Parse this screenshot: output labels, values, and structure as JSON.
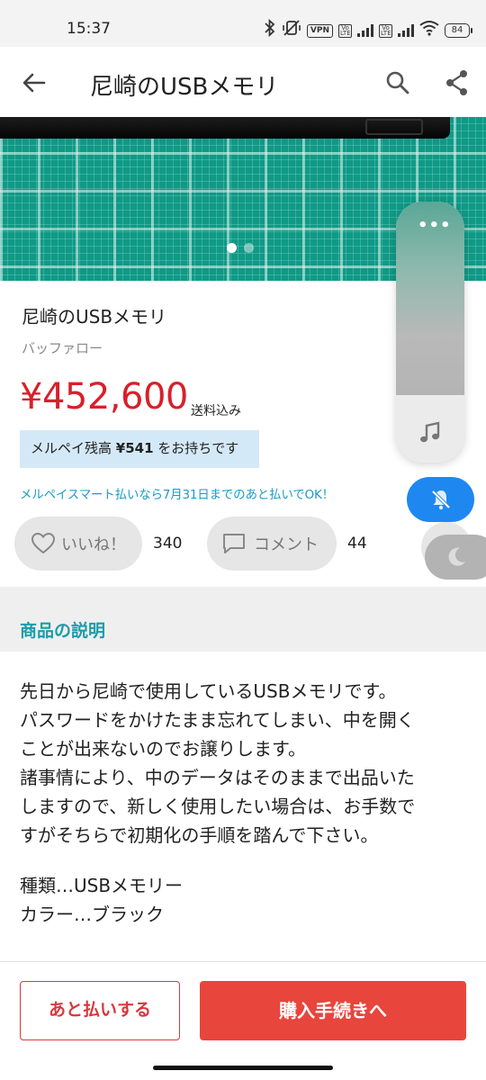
{
  "status_bar": {
    "time": "15:37",
    "icons": [
      "bluetooth-icon",
      "vibrate-off-icon",
      "vpn-icon",
      "volte-icon",
      "signal-icon",
      "volte-icon",
      "signal-icon",
      "wifi-icon",
      "battery-icon"
    ],
    "vpn_label": "VPN",
    "volte_label": "Vo LTE",
    "battery_level": "84"
  },
  "app_bar": {
    "title": "尼崎のUSBメモリ",
    "back_icon": "arrow-left-icon",
    "search_icon": "search-icon",
    "share_icon": "share-icon"
  },
  "gallery": {
    "page_count": 2,
    "current_page": 1
  },
  "product": {
    "title": "尼崎のUSBメモリ",
    "brand": "バッファロー",
    "price": "¥452,600",
    "shipping": "送料込み",
    "merpay_prefix": "メルペイ残高 ",
    "merpay_balance": "¥541",
    "merpay_suffix": " をお持ちです",
    "smart_pay_notice": "メルペイスマート払いなら7月31日までのあと払いでOK！"
  },
  "actions": {
    "like_label": "いいね！",
    "like_count": "340",
    "comment_label": "コメント",
    "comment_count": "44"
  },
  "description_section": {
    "title": "商品の説明",
    "lines": [
      "先日から尼崎で使用しているUSBメモリです。",
      "パスワードをかけたまま忘れてしまい、中を開く",
      "ことが出来ないのでお譲りします。",
      "諸事情により、中のデータはそのままで出品いた",
      "しますので、新しく使用したい場合は、お手数で",
      "すがそちらで初期化の手順を踏んで下さい。"
    ],
    "spec_type": "種類…USBメモリー",
    "spec_color": "カラー…ブラック"
  },
  "bottom_bar": {
    "later_pay_label": "あと払いする",
    "purchase_label": "購入手続きへ"
  },
  "volume_overlay": {
    "menu_label": "•••",
    "level": 0.74,
    "music_icon": "music-note-icon",
    "silent_icon": "bell-off-icon",
    "dnd_icon": "moon-icon"
  },
  "colors": {
    "price": "#d8202b",
    "accent_teal": "#1b9cab",
    "link_blue": "#1a9bc9",
    "purchase_red": "#e8453c",
    "merpay_box": "#d4e9f7",
    "silent_blue": "#1e88f0"
  }
}
